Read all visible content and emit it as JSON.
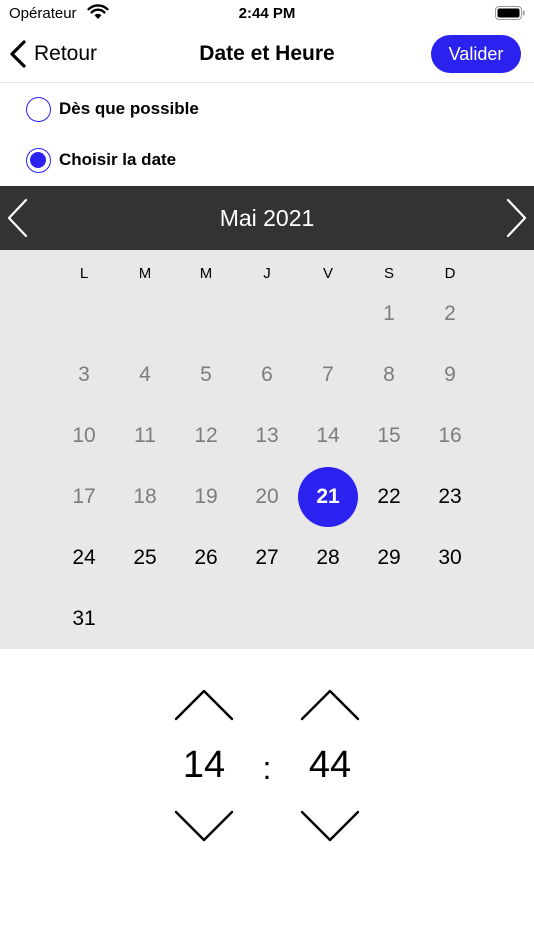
{
  "status_bar": {
    "carrier": "Opérateur",
    "time": "2:44 PM"
  },
  "nav": {
    "back_label": "Retour",
    "title": "Date et Heure",
    "validate_label": "Valider"
  },
  "options": {
    "asap_label": "Dès que possible",
    "asap_checked": false,
    "choose_label": "Choisir la date",
    "choose_checked": true
  },
  "calendar": {
    "month_title": "Mai 2021",
    "weekdays": [
      "L",
      "M",
      "M",
      "J",
      "V",
      "S",
      "D"
    ],
    "first_weekday_index": 5,
    "days_in_month": 31,
    "today": 21,
    "selected_day": 21
  },
  "time": {
    "hours": "14",
    "separator": ":",
    "minutes": "44"
  },
  "colors": {
    "accent": "#2b22f0",
    "header_bg": "#333333",
    "grid_bg": "#e8e8e8",
    "past_day": "#7d7d7d"
  }
}
